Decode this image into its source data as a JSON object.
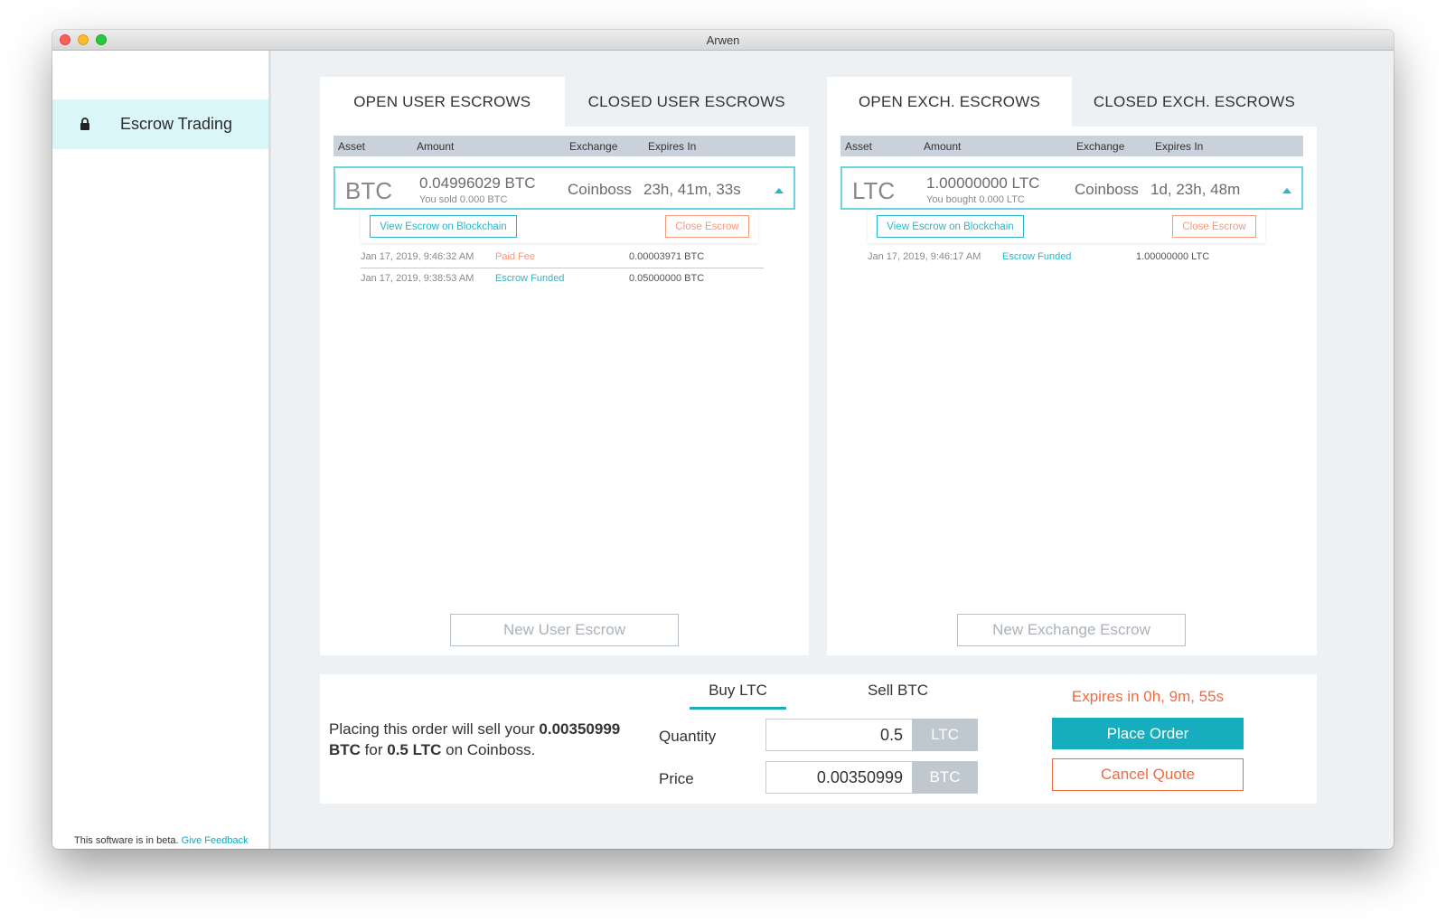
{
  "window": {
    "title": "Arwen"
  },
  "sidebar": {
    "nav_item": "Escrow Trading",
    "beta_text": "This software is in beta. ",
    "feedback_link": "Give Feedback"
  },
  "table_headers": {
    "asset": "Asset",
    "amount": "Amount",
    "exchange": "Exchange",
    "expires": "Expires In"
  },
  "user_panel": {
    "tabs": [
      "OPEN USER ESCROWS",
      "CLOSED USER ESCROWS"
    ],
    "escrow": {
      "asset": "BTC",
      "amount": "0.04996029 BTC",
      "sub": "You sold 0.000 BTC",
      "exchange": "Coinboss",
      "expires": "23h, 41m, 33s",
      "view_button": "View Escrow on Blockchain",
      "close_button": "Close Escrow",
      "history": [
        {
          "date": "Jan 17, 2019, 9:46:32 AM",
          "event": "Paid Fee",
          "value": "0.00003971 BTC"
        },
        {
          "date": "Jan 17, 2019, 9:38:53 AM",
          "event": "Escrow Funded",
          "value": "0.05000000 BTC"
        }
      ]
    },
    "new_button": "New User Escrow"
  },
  "exch_panel": {
    "tabs": [
      "OPEN EXCH. ESCROWS",
      "CLOSED EXCH. ESCROWS"
    ],
    "escrow": {
      "asset": "LTC",
      "amount": "1.00000000 LTC",
      "sub": "You bought 0.000 LTC",
      "exchange": "Coinboss",
      "expires": "1d, 23h, 48m",
      "view_button": "View Escrow on Blockchain",
      "close_button": "Close Escrow",
      "history": [
        {
          "date": "Jan 17, 2019, 9:46:17 AM",
          "event": "Escrow Funded",
          "value": "1.00000000 LTC"
        }
      ]
    },
    "new_button": "New Exchange Escrow"
  },
  "order": {
    "summary_pre": "Placing this order will sell your ",
    "summary_amount": "0.00350999 BTC",
    "summary_mid": " for ",
    "summary_qty": "0.5 LTC",
    "summary_post": " on Coinboss.",
    "tabs": [
      "Buy LTC",
      "Sell BTC"
    ],
    "quantity_label": "Quantity",
    "quantity_value": "0.5",
    "quantity_unit": "LTC",
    "price_label": "Price",
    "price_value": "0.00350999",
    "price_unit": "BTC",
    "expires": "Expires in 0h, 9m, 55s",
    "place_button": "Place Order",
    "cancel_button": "Cancel Quote"
  },
  "colors": {
    "accent": "#16aebf",
    "warning": "#f06a3f",
    "highlight": "#dbf6f9"
  },
  "icons": {
    "nav_item": "lock-icon"
  }
}
